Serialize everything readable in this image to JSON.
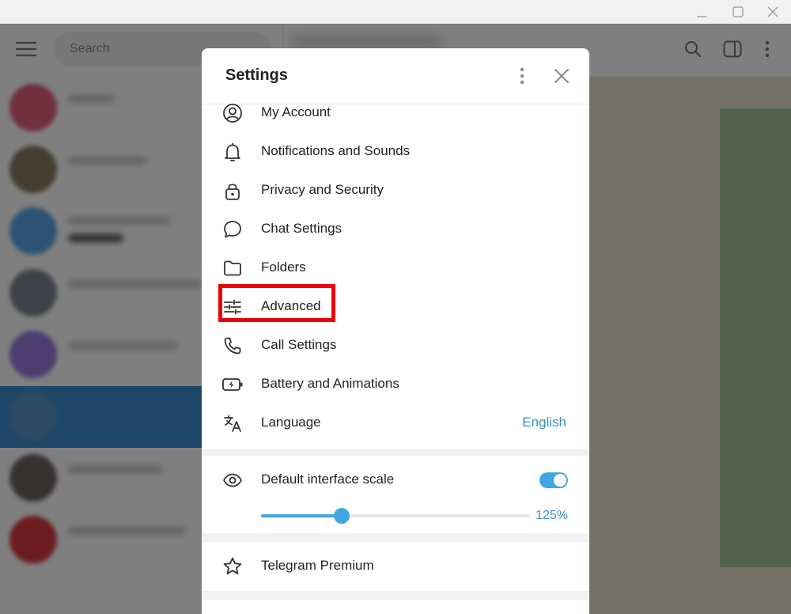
{
  "search": {
    "placeholder": "Search"
  },
  "settings": {
    "title": "Settings",
    "items": [
      {
        "label": "My Account",
        "icon": "account-icon"
      },
      {
        "label": "Notifications and Sounds",
        "icon": "bell-icon"
      },
      {
        "label": "Privacy and Security",
        "icon": "lock-icon"
      },
      {
        "label": "Chat Settings",
        "icon": "chat-bubble-icon"
      },
      {
        "label": "Folders",
        "icon": "folder-icon"
      },
      {
        "label": "Advanced",
        "icon": "sliders-icon"
      },
      {
        "label": "Call Settings",
        "icon": "phone-icon"
      },
      {
        "label": "Battery and Animations",
        "icon": "battery-icon"
      },
      {
        "label": "Language",
        "value": "English",
        "icon": "translate-icon"
      }
    ],
    "scale": {
      "label": "Default interface scale",
      "toggle_on": true,
      "value_label": "125%",
      "slider_fraction": 0.3
    },
    "premium": {
      "label": "Telegram Premium",
      "icon": "star-icon"
    }
  },
  "colors": {
    "accent": "#40a7e3",
    "highlight": "#ee0000",
    "link": "#3a8fc9"
  }
}
